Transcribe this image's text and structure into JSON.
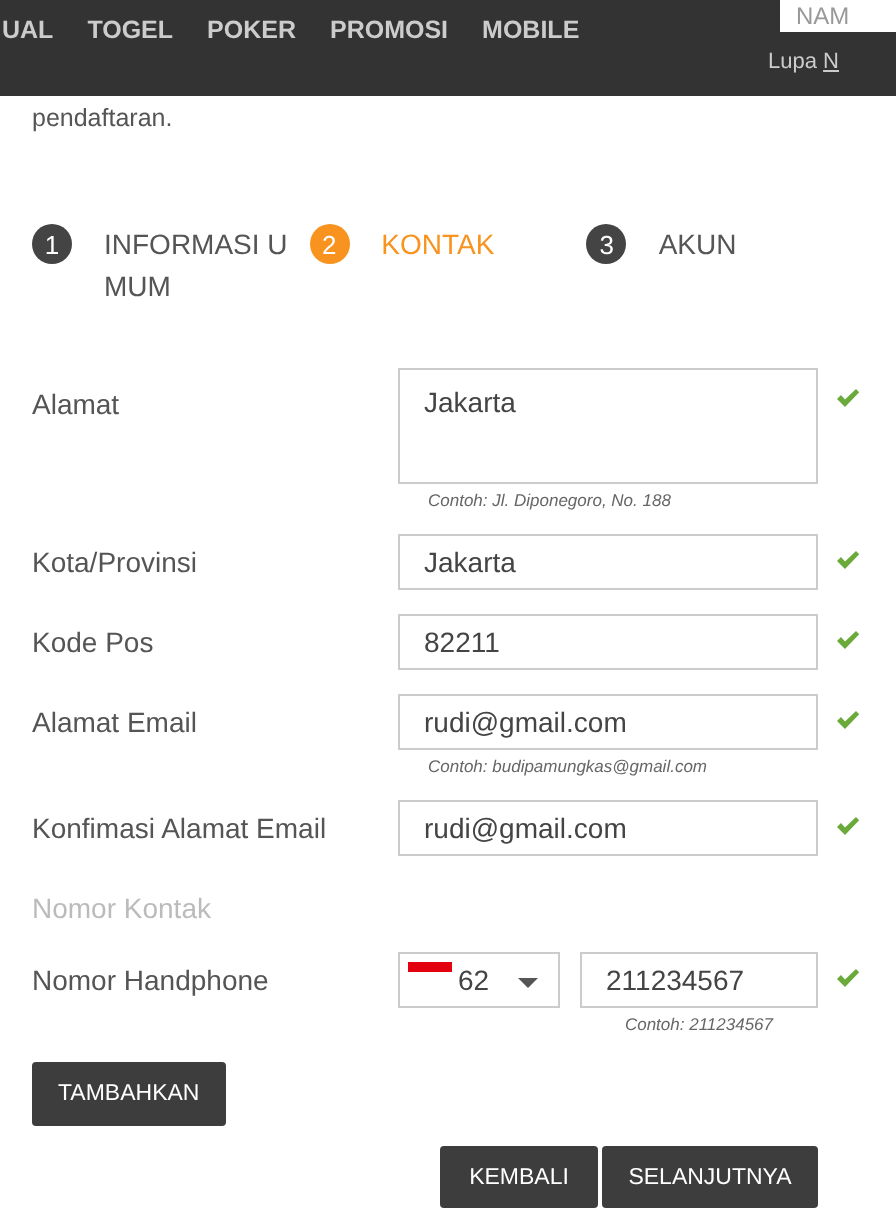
{
  "nav": {
    "items": [
      "UAL",
      "TOGEL",
      "POKER",
      "PROMOSI",
      "MOBILE"
    ]
  },
  "login": {
    "placeholder": "NAM",
    "forgot_text": "Lupa",
    "forgot_link": "N"
  },
  "intro": "pendaftaran.",
  "steps": [
    {
      "number": "1",
      "label": "INFORMASI UMUM",
      "selected": false
    },
    {
      "number": "2",
      "label": "KONTAK",
      "selected": true
    },
    {
      "number": "3",
      "label": "AKUN",
      "selected": false
    }
  ],
  "rows": [
    {
      "kind": "textarea",
      "label": "Alamat",
      "value": "Jakarta",
      "hint": "Contoh: Jl. Diponegoro, No. 188",
      "valid": true
    },
    {
      "kind": "text",
      "label": "Kota/Provinsi",
      "value": "Jakarta",
      "valid": true
    },
    {
      "kind": "text",
      "label": "Kode Pos",
      "value": "82211",
      "valid": true
    },
    {
      "kind": "text",
      "label": "Alamat Email",
      "value": "rudi@gmail.com",
      "hint": "Contoh: budipamungkas@gmail.com",
      "valid": true
    },
    {
      "kind": "text",
      "label": "Konfimasi Alamat Email",
      "value": "rudi@gmail.com",
      "valid": true
    },
    {
      "kind": "section",
      "label": "Nomor Kontak"
    },
    {
      "kind": "phone",
      "label": "Nomor Handphone",
      "code": "62",
      "value": "211234567",
      "hint": "Contoh: 211234567",
      "valid": true
    }
  ],
  "add_button": "TAMBAHKAN",
  "back_button": "KEMBALI",
  "next_button": "SELANJUTNYA"
}
